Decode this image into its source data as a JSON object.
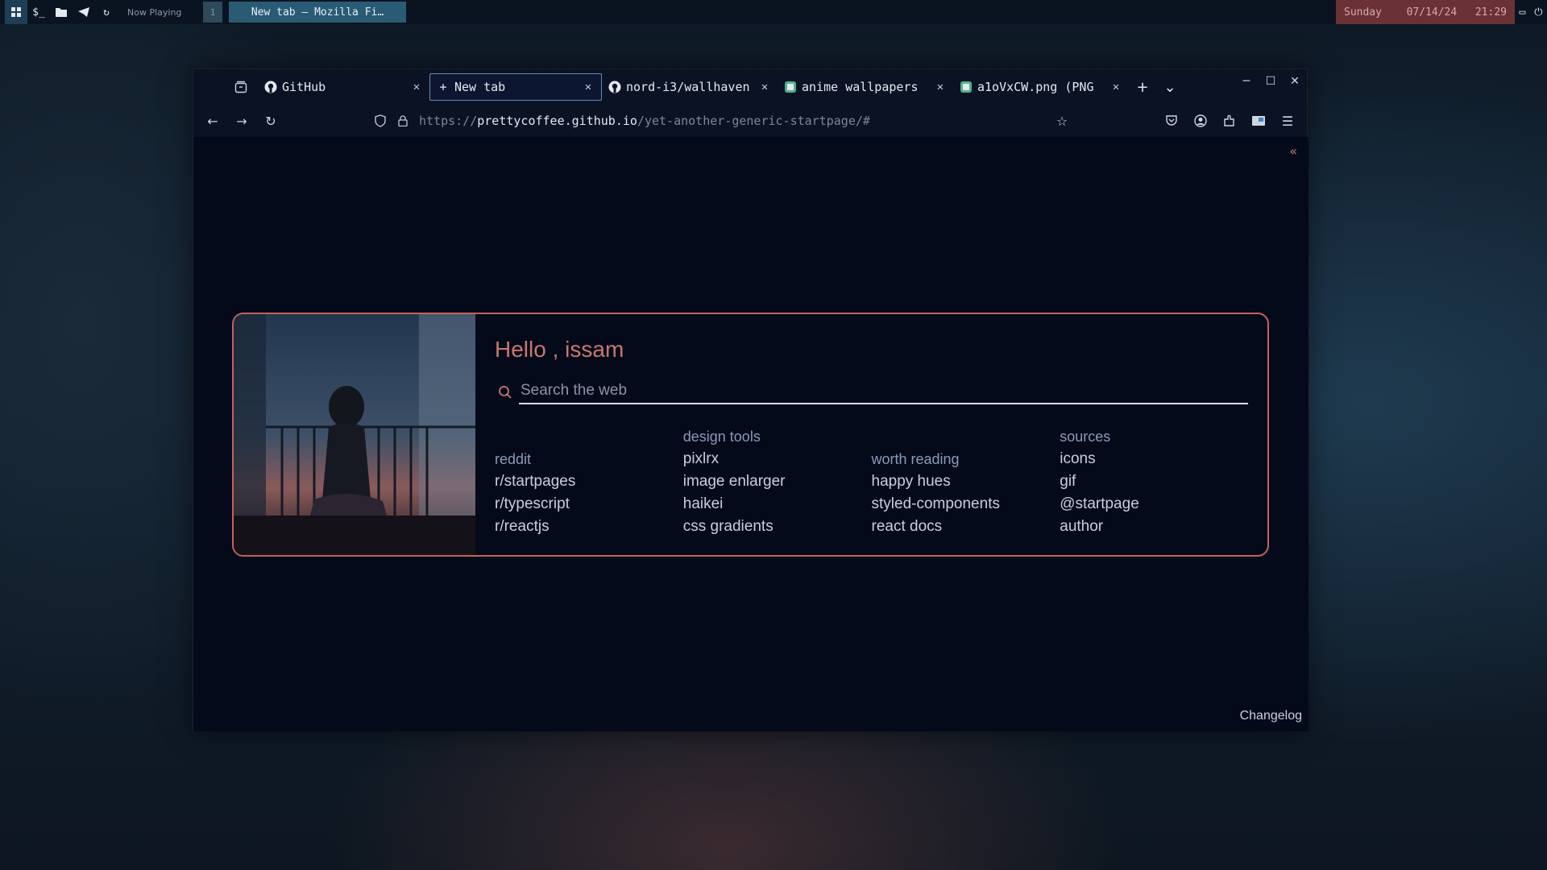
{
  "topbar": {
    "now_playing": "Now Playing",
    "workspace_number": "1",
    "window_title": "New tab — Mozilla Fi…",
    "day": "Sunday",
    "date": "07/14/24",
    "time": "21:29"
  },
  "browser": {
    "tabs": [
      {
        "label": "GitHub",
        "icon": "github-icon",
        "active": false
      },
      {
        "label": "New tab",
        "icon": "plus-icon",
        "active": true
      },
      {
        "label": "nord-i3/wallhaven",
        "icon": "github-icon",
        "active": false
      },
      {
        "label": "anime wallpapers",
        "icon": "wallhaven-icon",
        "active": false
      },
      {
        "label": "a1oVxCW.png (PNG",
        "icon": "wallhaven-icon",
        "active": false
      }
    ],
    "url": {
      "scheme": "https://",
      "host": "prettycoffee.github.io",
      "path": "/yet-another-generic-startpage/#"
    }
  },
  "startpage": {
    "greeting": "Hello , issam",
    "search_placeholder": "Search the web",
    "columns": [
      {
        "heading": "",
        "group": "reddit",
        "links": [
          "r/startpages",
          "r/typescript",
          "r/reactjs"
        ]
      },
      {
        "heading": "design tools",
        "group": "",
        "links": [
          "pixlrx",
          "image enlarger",
          "haikei",
          "css gradients"
        ]
      },
      {
        "heading": "",
        "group": "worth reading",
        "links": [
          "happy hues",
          "styled-components",
          "react docs"
        ]
      },
      {
        "heading": "sources",
        "group": "",
        "links": [
          "icons",
          "gif",
          "@startpage",
          "author"
        ]
      }
    ],
    "changelog": "Changelog"
  },
  "colors": {
    "accent": "#c77770",
    "border": "#c4625c",
    "heading": "#8a9bb8",
    "background": "#050a1a"
  }
}
